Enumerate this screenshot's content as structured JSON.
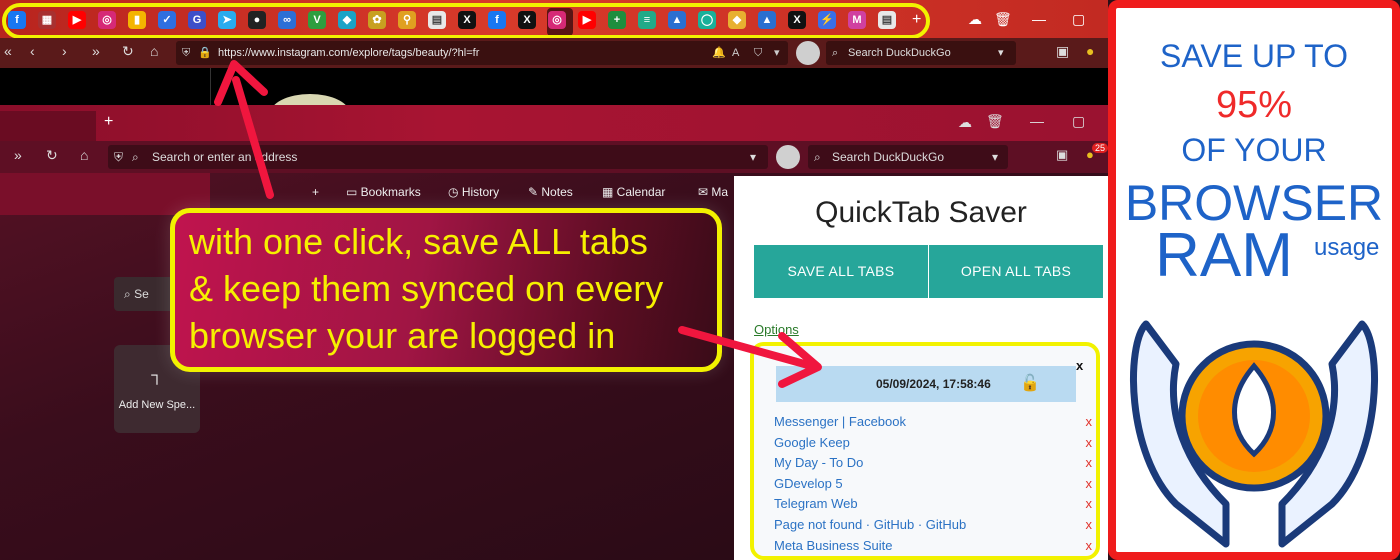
{
  "top_window": {
    "tab_icons": [
      {
        "name": "facebook-icon",
        "color": "#1877f2",
        "glyph": "f"
      },
      {
        "name": "apps-grid-icon",
        "color": "#a83030",
        "glyph": "▦"
      },
      {
        "name": "youtube-icon",
        "color": "#ff0000",
        "glyph": "▶"
      },
      {
        "name": "instagram-icon",
        "color": "#d62976",
        "glyph": "◎"
      },
      {
        "name": "keep-icon",
        "color": "#f4b400",
        "glyph": "▮"
      },
      {
        "name": "todo-icon",
        "color": "#2f6fe0",
        "glyph": "✓"
      },
      {
        "name": "gdevelop-icon",
        "color": "#3d4fc9",
        "glyph": "G"
      },
      {
        "name": "telegram-icon",
        "color": "#2aabee",
        "glyph": "➤"
      },
      {
        "name": "github-icon",
        "color": "#222222",
        "glyph": "●"
      },
      {
        "name": "meta-icon",
        "color": "#2b6fd6",
        "glyph": "∞"
      },
      {
        "name": "v-icon",
        "color": "#2e9e3f",
        "glyph": "V"
      },
      {
        "name": "bird-icon",
        "color": "#1aa3c7",
        "glyph": "◆"
      },
      {
        "name": "colorful-icon",
        "color": "#c8a020",
        "glyph": "✿"
      },
      {
        "name": "pin-icon",
        "color": "#e0a020",
        "glyph": "⚲"
      },
      {
        "name": "document-icon",
        "color": "#e8e8e8",
        "glyph": "▤"
      },
      {
        "name": "x-icon",
        "color": "#111111",
        "glyph": "X"
      },
      {
        "name": "facebook-icon",
        "color": "#1877f2",
        "glyph": "f"
      },
      {
        "name": "x-icon",
        "color": "#111111",
        "glyph": "X"
      },
      {
        "name": "instagram-icon",
        "color": "#d62976",
        "glyph": "◎"
      },
      {
        "name": "youtube-icon",
        "color": "#ff0000",
        "glyph": "▶"
      },
      {
        "name": "sheets-icon",
        "color": "#1e8e3e",
        "glyph": "+"
      },
      {
        "name": "list-icon",
        "color": "#22aa88",
        "glyph": "≡"
      },
      {
        "name": "sail-icon",
        "color": "#2a6fd0",
        "glyph": "▲"
      },
      {
        "name": "circle-icon",
        "color": "#18b09a",
        "glyph": "◯"
      },
      {
        "name": "diamond-icon",
        "color": "#e8b030",
        "glyph": "◆"
      },
      {
        "name": "sail-icon",
        "color": "#2a6fd0",
        "glyph": "▲"
      },
      {
        "name": "x-icon",
        "color": "#111111",
        "glyph": "X"
      },
      {
        "name": "bolt-icon",
        "color": "#3a6fe8",
        "glyph": "⚡"
      },
      {
        "name": "mc-icon",
        "color": "#d040a0",
        "glyph": "M"
      },
      {
        "name": "document-icon",
        "color": "#e8e8e8",
        "glyph": "▤"
      }
    ],
    "url": "https://www.instagram.com/explore/tags/beauty/?hl=fr",
    "search_placeholder": "Search DuckDuckGo"
  },
  "bottom_window": {
    "url_placeholder": "Search or enter an address",
    "search_placeholder": "Search DuckDuckGo",
    "notification_count": "25",
    "bookmarks": [
      "Bookmarks",
      "History",
      "Notes",
      "Calendar",
      "Ma"
    ],
    "speed_search_label": "Se",
    "add_speed_label": "Add New Spe..."
  },
  "popup": {
    "title": "QuickTab Saver",
    "save_button": "SAVE ALL TABS",
    "open_button": "OPEN ALL TABS",
    "options_link": "Options",
    "saved_at": "05/09/2024, 17:58:46",
    "close_label": "x",
    "tabs": [
      "Messenger | Facebook",
      "Google Keep",
      "My Day - To Do",
      "GDevelop 5",
      "Telegram Web",
      "Page not found · GitHub · GitHub",
      "Meta Business Suite"
    ],
    "delete_label": "x"
  },
  "callout": {
    "lines": [
      "with one click, save ALL tabs",
      "& keep them synced on every",
      "browser your are logged in"
    ]
  },
  "ad": {
    "line1": "SAVE UP TO",
    "percent": "95%",
    "line3": "OF YOUR",
    "line4": "BROWSER",
    "line5": "RAM",
    "line5_suffix": "usage",
    "accent_blue": "#1e63c8",
    "accent_red": "#ef1c1c"
  }
}
